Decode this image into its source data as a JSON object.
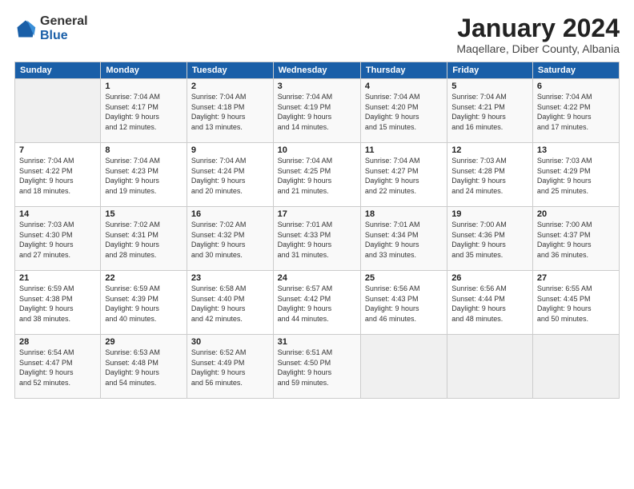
{
  "header": {
    "logo_general": "General",
    "logo_blue": "Blue",
    "month_title": "January 2024",
    "location": "Maqellare, Diber County, Albania"
  },
  "days_of_week": [
    "Sunday",
    "Monday",
    "Tuesday",
    "Wednesday",
    "Thursday",
    "Friday",
    "Saturday"
  ],
  "weeks": [
    [
      {
        "day": "",
        "info": ""
      },
      {
        "day": "1",
        "info": "Sunrise: 7:04 AM\nSunset: 4:17 PM\nDaylight: 9 hours\nand 12 minutes."
      },
      {
        "day": "2",
        "info": "Sunrise: 7:04 AM\nSunset: 4:18 PM\nDaylight: 9 hours\nand 13 minutes."
      },
      {
        "day": "3",
        "info": "Sunrise: 7:04 AM\nSunset: 4:19 PM\nDaylight: 9 hours\nand 14 minutes."
      },
      {
        "day": "4",
        "info": "Sunrise: 7:04 AM\nSunset: 4:20 PM\nDaylight: 9 hours\nand 15 minutes."
      },
      {
        "day": "5",
        "info": "Sunrise: 7:04 AM\nSunset: 4:21 PM\nDaylight: 9 hours\nand 16 minutes."
      },
      {
        "day": "6",
        "info": "Sunrise: 7:04 AM\nSunset: 4:22 PM\nDaylight: 9 hours\nand 17 minutes."
      }
    ],
    [
      {
        "day": "7",
        "info": "Sunrise: 7:04 AM\nSunset: 4:22 PM\nDaylight: 9 hours\nand 18 minutes."
      },
      {
        "day": "8",
        "info": "Sunrise: 7:04 AM\nSunset: 4:23 PM\nDaylight: 9 hours\nand 19 minutes."
      },
      {
        "day": "9",
        "info": "Sunrise: 7:04 AM\nSunset: 4:24 PM\nDaylight: 9 hours\nand 20 minutes."
      },
      {
        "day": "10",
        "info": "Sunrise: 7:04 AM\nSunset: 4:25 PM\nDaylight: 9 hours\nand 21 minutes."
      },
      {
        "day": "11",
        "info": "Sunrise: 7:04 AM\nSunset: 4:27 PM\nDaylight: 9 hours\nand 22 minutes."
      },
      {
        "day": "12",
        "info": "Sunrise: 7:03 AM\nSunset: 4:28 PM\nDaylight: 9 hours\nand 24 minutes."
      },
      {
        "day": "13",
        "info": "Sunrise: 7:03 AM\nSunset: 4:29 PM\nDaylight: 9 hours\nand 25 minutes."
      }
    ],
    [
      {
        "day": "14",
        "info": "Sunrise: 7:03 AM\nSunset: 4:30 PM\nDaylight: 9 hours\nand 27 minutes."
      },
      {
        "day": "15",
        "info": "Sunrise: 7:02 AM\nSunset: 4:31 PM\nDaylight: 9 hours\nand 28 minutes."
      },
      {
        "day": "16",
        "info": "Sunrise: 7:02 AM\nSunset: 4:32 PM\nDaylight: 9 hours\nand 30 minutes."
      },
      {
        "day": "17",
        "info": "Sunrise: 7:01 AM\nSunset: 4:33 PM\nDaylight: 9 hours\nand 31 minutes."
      },
      {
        "day": "18",
        "info": "Sunrise: 7:01 AM\nSunset: 4:34 PM\nDaylight: 9 hours\nand 33 minutes."
      },
      {
        "day": "19",
        "info": "Sunrise: 7:00 AM\nSunset: 4:36 PM\nDaylight: 9 hours\nand 35 minutes."
      },
      {
        "day": "20",
        "info": "Sunrise: 7:00 AM\nSunset: 4:37 PM\nDaylight: 9 hours\nand 36 minutes."
      }
    ],
    [
      {
        "day": "21",
        "info": "Sunrise: 6:59 AM\nSunset: 4:38 PM\nDaylight: 9 hours\nand 38 minutes."
      },
      {
        "day": "22",
        "info": "Sunrise: 6:59 AM\nSunset: 4:39 PM\nDaylight: 9 hours\nand 40 minutes."
      },
      {
        "day": "23",
        "info": "Sunrise: 6:58 AM\nSunset: 4:40 PM\nDaylight: 9 hours\nand 42 minutes."
      },
      {
        "day": "24",
        "info": "Sunrise: 6:57 AM\nSunset: 4:42 PM\nDaylight: 9 hours\nand 44 minutes."
      },
      {
        "day": "25",
        "info": "Sunrise: 6:56 AM\nSunset: 4:43 PM\nDaylight: 9 hours\nand 46 minutes."
      },
      {
        "day": "26",
        "info": "Sunrise: 6:56 AM\nSunset: 4:44 PM\nDaylight: 9 hours\nand 48 minutes."
      },
      {
        "day": "27",
        "info": "Sunrise: 6:55 AM\nSunset: 4:45 PM\nDaylight: 9 hours\nand 50 minutes."
      }
    ],
    [
      {
        "day": "28",
        "info": "Sunrise: 6:54 AM\nSunset: 4:47 PM\nDaylight: 9 hours\nand 52 minutes."
      },
      {
        "day": "29",
        "info": "Sunrise: 6:53 AM\nSunset: 4:48 PM\nDaylight: 9 hours\nand 54 minutes."
      },
      {
        "day": "30",
        "info": "Sunrise: 6:52 AM\nSunset: 4:49 PM\nDaylight: 9 hours\nand 56 minutes."
      },
      {
        "day": "31",
        "info": "Sunrise: 6:51 AM\nSunset: 4:50 PM\nDaylight: 9 hours\nand 59 minutes."
      },
      {
        "day": "",
        "info": ""
      },
      {
        "day": "",
        "info": ""
      },
      {
        "day": "",
        "info": ""
      }
    ]
  ]
}
